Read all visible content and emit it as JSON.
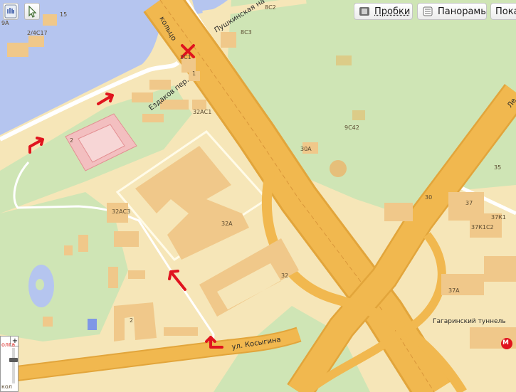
{
  "toolbar": {
    "traffic_label": "Пробки",
    "panoramas_label": "Панорамы",
    "show_label": "Пока",
    "traffic_icon": "traffic-icon",
    "panorama_icon": "panorama-icon",
    "hand_icon": "hand-tool-icon",
    "pointer_icon": "pointer-tool-icon"
  },
  "streets": {
    "ring": "кольцо",
    "pushkinskaya": "Пушкинская на",
    "ezdakov": "Ездаков пер.",
    "kosygina": "ул. Косыгина",
    "gagarin_tunnel": "Гагаринский туннель",
    "le": "Ле"
  },
  "buildings": {
    "b15": "15",
    "b9a": "9А",
    "b2_4c17": "2/4С17",
    "b8c2": "8С2",
    "b8c3": "8С3",
    "b2c1": "2С1",
    "b1": "1",
    "b32ac1": "32АС1",
    "b2_left": "2",
    "b9c42": "9С42",
    "b30a": "30А",
    "b35": "35",
    "b30": "30",
    "b37": "37",
    "b37k1": "37К1",
    "b37k1c2": "37К1С2",
    "b32ac3": "32АС3",
    "b32a": "32А",
    "b32": "32",
    "b37a": "37А",
    "b2_bottom": "2"
  },
  "metro": {
    "label": "М",
    "edge_text": "олга",
    "edge_text2": "кол"
  },
  "zoom": {
    "plus": "+",
    "minus": "−"
  },
  "colors": {
    "water": "#b5c5ef",
    "park": "#cfe5b5",
    "background": "#f6e6b8",
    "road_major": "#f1b84f",
    "building": "#f0c88a",
    "route_arrow": "#e0141e",
    "metro": "#e0141e"
  }
}
